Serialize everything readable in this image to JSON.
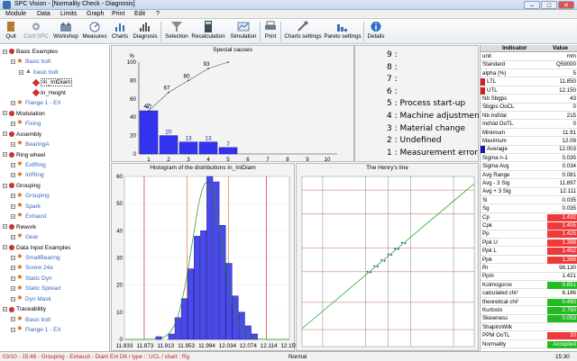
{
  "window": {
    "title": "SPC Vision - [Normality Check - Diagnosis]",
    "controls": [
      "–",
      "□",
      "✕"
    ]
  },
  "menu": [
    "Module",
    "Data",
    "Limits",
    "Graph",
    "Print",
    "Edit",
    "?"
  ],
  "toolbar": [
    {
      "label": "Quit",
      "icon": "door-icon"
    },
    {
      "label": "Conf SPC",
      "icon": "gear-icon"
    },
    {
      "label": "Workshop",
      "icon": "workshop-icon"
    },
    {
      "label": "Measures",
      "icon": "gauge-icon"
    },
    {
      "label": "Charts",
      "icon": "chart-icon"
    },
    {
      "label": "Diagnosis",
      "icon": "diagnosis-icon"
    },
    {
      "label": "Selection",
      "icon": "funnel-icon"
    },
    {
      "label": "Recalculation",
      "icon": "calculator-icon"
    },
    {
      "label": "Simulation",
      "icon": "simulation-icon"
    },
    {
      "label": "Print",
      "icon": "printer-icon"
    },
    {
      "label": "Charts settings",
      "icon": "wrench-icon"
    },
    {
      "label": "Pareto settings",
      "icon": "pareto-icon"
    },
    {
      "label": "Details",
      "icon": "info-icon"
    }
  ],
  "tree": [
    {
      "level": 0,
      "label": "Basic Examples",
      "kind": "group"
    },
    {
      "level": 1,
      "label": "Basic bolt",
      "kind": "star"
    },
    {
      "level": 2,
      "label": "basic bolt",
      "kind": "part"
    },
    {
      "level": 3,
      "label": "In_IntDiam",
      "kind": "char-selected"
    },
    {
      "level": 3,
      "label": "In_Height",
      "kind": "char"
    },
    {
      "level": 1,
      "label": "Flange 1 - EX",
      "kind": "star"
    },
    {
      "level": 0,
      "label": "Modulation",
      "kind": "group"
    },
    {
      "level": 1,
      "label": "Fixing",
      "kind": "star"
    },
    {
      "level": 0,
      "label": "Assembly",
      "kind": "group"
    },
    {
      "level": 1,
      "label": "BearingA",
      "kind": "star"
    },
    {
      "level": 0,
      "label": "Ring wheel",
      "kind": "group"
    },
    {
      "level": 1,
      "label": "ExtRing",
      "kind": "star"
    },
    {
      "level": 1,
      "label": "IntRing",
      "kind": "star"
    },
    {
      "level": 0,
      "label": "Grouping",
      "kind": "group"
    },
    {
      "level": 1,
      "label": "Grouping",
      "kind": "star"
    },
    {
      "level": 1,
      "label": "Spark",
      "kind": "star"
    },
    {
      "level": 1,
      "label": "Exhaust",
      "kind": "star"
    },
    {
      "level": 0,
      "label": "Rework",
      "kind": "group"
    },
    {
      "level": 1,
      "label": "Gear",
      "kind": "star"
    },
    {
      "level": 0,
      "label": "Data Input Examples",
      "kind": "group"
    },
    {
      "level": 1,
      "label": "SmallBearing",
      "kind": "star"
    },
    {
      "level": 1,
      "label": "Screw 24a",
      "kind": "star"
    },
    {
      "level": 1,
      "label": "Static Dyn",
      "kind": "star"
    },
    {
      "level": 1,
      "label": "Static Spread",
      "kind": "star"
    },
    {
      "level": 1,
      "label": "Dyn Mask",
      "kind": "star"
    },
    {
      "level": 0,
      "label": "Traceability",
      "kind": "group"
    },
    {
      "level": 1,
      "label": "Basic bolt",
      "kind": "star"
    },
    {
      "level": 1,
      "label": "Flange 1 - EX",
      "kind": "star"
    }
  ],
  "chart_data": [
    {
      "type": "bar",
      "title": "Special causes",
      "ylabel": "%",
      "categories": [
        "1",
        "2",
        "3",
        "4",
        "5",
        "6",
        "7",
        "8",
        "9",
        "10"
      ],
      "values": [
        47,
        20,
        13,
        13,
        7,
        0,
        0,
        0,
        0,
        0
      ],
      "cumulative": [
        47,
        67,
        80,
        93,
        100
      ],
      "ylim": [
        0,
        100
      ],
      "yticks": [
        0,
        20,
        40,
        60,
        80,
        100
      ]
    },
    {
      "type": "bar",
      "title": "Histogram of the distributions In_IntDiam",
      "xticks": [
        "11.833",
        "11.873",
        "11.913",
        "11.953",
        "11.994",
        "12.034",
        "12.074",
        "12.114",
        "12.155"
      ],
      "yticks": [
        0,
        10,
        20,
        30,
        40,
        50,
        60
      ],
      "ylim": [
        0,
        60
      ],
      "values": [
        1,
        0,
        2,
        8,
        15,
        26,
        38,
        40,
        60,
        58,
        42,
        28,
        16,
        10,
        5,
        2
      ]
    },
    {
      "type": "scatter",
      "title": "The Henry's line"
    }
  ],
  "legend_lines": [
    {
      "label": "9 :"
    },
    {
      "label": "8 :"
    },
    {
      "label": "7 :"
    },
    {
      "label": "6 :"
    },
    {
      "label": "5 : Process start-up"
    },
    {
      "label": "4 : Machine adjustment"
    },
    {
      "label": "3 : Material change"
    },
    {
      "label": "2 : Undefined"
    },
    {
      "label": "1 : Measurement error"
    }
  ],
  "indicators": {
    "header_name": "Indicator",
    "header_value": "Value",
    "rows": [
      {
        "name": "unit",
        "value": "mm"
      },
      {
        "name": "Standard",
        "value": "Q59000"
      },
      {
        "name": "alpha (%)",
        "value": "5"
      },
      {
        "name": "LTL",
        "value": "11.850",
        "marker": "#cc2222"
      },
      {
        "name": "UTL",
        "value": "12.150",
        "marker": "#cc2222"
      },
      {
        "name": "Nb Sbgps",
        "value": "43"
      },
      {
        "name": "Sbgps OoCL",
        "value": "0"
      },
      {
        "name": "Nb IndVal",
        "value": "215"
      },
      {
        "name": "IndVal OoTL",
        "value": "0"
      },
      {
        "name": "Minimum",
        "value": "11.91"
      },
      {
        "name": "Maximum",
        "value": "12.09"
      },
      {
        "name": "Average",
        "value": "12.003",
        "marker": "#1a1aa8"
      },
      {
        "name": "Sigma n-1",
        "value": "0.035"
      },
      {
        "name": "Sigma Avg",
        "value": "0.034"
      },
      {
        "name": "Avg Range",
        "value": "0.081"
      },
      {
        "name": "Avg - 3 Sig",
        "value": "11.897"
      },
      {
        "name": "Avg + 3 Sig",
        "value": "12.111"
      },
      {
        "name": "Si",
        "value": "0.035"
      },
      {
        "name": "Sg",
        "value": "0.035"
      },
      {
        "name": "Cp",
        "value": "1.432",
        "color": "#ee3a3a"
      },
      {
        "name": "Cpk",
        "value": "1.405",
        "color": "#ee3a3a"
      },
      {
        "name": "Pp",
        "value": "1.425",
        "color": "#ee3a3a"
      },
      {
        "name": "Ppk U",
        "value": "1.398",
        "color": "#ee3a3a"
      },
      {
        "name": "Ppk L",
        "value": "1.452",
        "color": "#ee3a3a"
      },
      {
        "name": "Ppk",
        "value": "1.398",
        "color": "#ee3a3a"
      },
      {
        "name": "Rr",
        "value": "98.130"
      },
      {
        "name": "Ppm",
        "value": "1.421"
      },
      {
        "name": "Kolmogorov",
        "value": "0.851",
        "color": "#22bb22"
      },
      {
        "name": "calculated chi²",
        "value": "6.186"
      },
      {
        "name": "theoretical chi²",
        "value": "0.490",
        "color": "#22bb22"
      },
      {
        "name": "Kurtosis",
        "value": "2.750",
        "color": "#22bb22"
      },
      {
        "name": "Skewness",
        "value": "0.053",
        "color": "#22bb22"
      },
      {
        "name": "ShapiroWilk",
        "value": ""
      },
      {
        "name": "PPM OoTL",
        "value": "20",
        "color": "#ee3a3a"
      },
      {
        "name": "Normality",
        "value": "Accepted",
        "color": "#22bb22"
      }
    ]
  },
  "status": {
    "left": "03/10 - 15:48 - Grouping - Exhaust - Diam Ext  D6  / type :: UCL  / chart : Rg",
    "mid": "Normal",
    "right": "15:30"
  }
}
